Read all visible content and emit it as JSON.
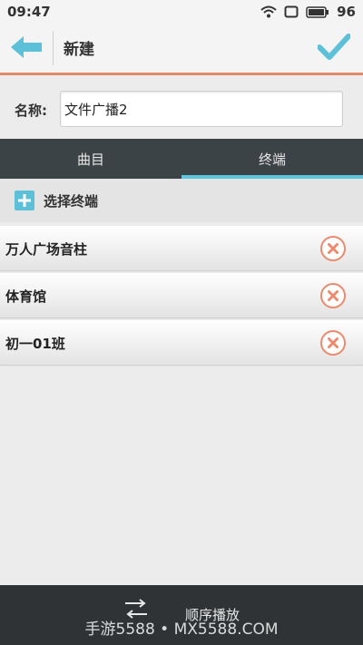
{
  "status_bar": {
    "time": "09:47",
    "battery": "96"
  },
  "header": {
    "title": "新建"
  },
  "name_field": {
    "label": "名称:",
    "value": "文件广播2"
  },
  "tabs": [
    {
      "label": "曲目",
      "active": false
    },
    {
      "label": "终端",
      "active": true
    }
  ],
  "select_terminal": {
    "label": "选择终端"
  },
  "terminals": [
    {
      "name": "万人广场音柱"
    },
    {
      "name": "体育馆"
    },
    {
      "name": "初一01班"
    }
  ],
  "bottom_bar": {
    "mode_label": "顺序播放"
  },
  "watermark": "手游5588 • MX5588.COM",
  "colors": {
    "accent": "#5bc6dc",
    "header_underline": "#e08a6a",
    "remove": "#ec8a6e",
    "tab_bar": "#3c4347"
  }
}
